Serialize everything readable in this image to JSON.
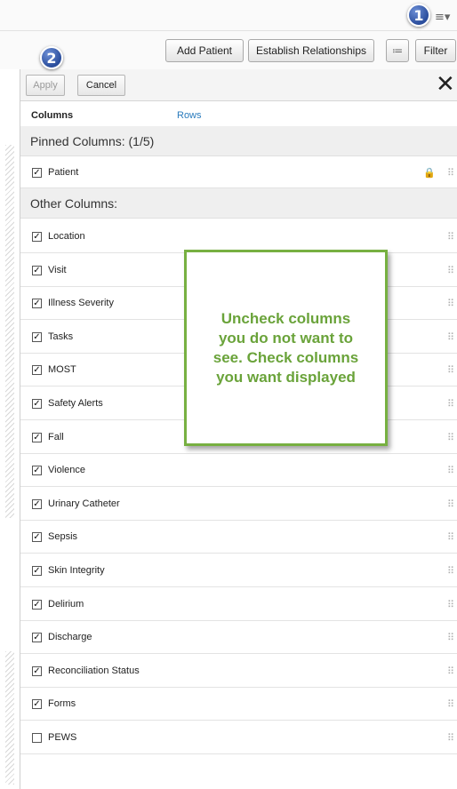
{
  "toolbar": {
    "menu_icon": "≡▾",
    "add_patient_label": "Add Patient",
    "establish_relationships_label": "Establish Relationships",
    "settings_icon": "≔",
    "filter_label": "Filter"
  },
  "badges": {
    "one": "1",
    "two": "2"
  },
  "panel": {
    "apply_label": "Apply",
    "cancel_label": "Cancel",
    "close_icon": "✕",
    "tabs": {
      "columns": "Columns",
      "rows": "Rows"
    },
    "pinned_header": "Pinned Columns: (1/5)",
    "other_header": "Other Columns:",
    "pinned_items": [
      {
        "label": "Patient",
        "checked": true,
        "locked": true
      }
    ],
    "other_items": [
      {
        "label": "Location",
        "checked": true
      },
      {
        "label": "Visit",
        "checked": true
      },
      {
        "label": "Illness Severity",
        "checked": true
      },
      {
        "label": "Tasks",
        "checked": true
      },
      {
        "label": "MOST",
        "checked": true
      },
      {
        "label": "Safety Alerts",
        "checked": true
      },
      {
        "label": "Fall",
        "checked": true
      },
      {
        "label": "Violence",
        "checked": true
      },
      {
        "label": "Urinary Catheter",
        "checked": true
      },
      {
        "label": "Sepsis",
        "checked": true
      },
      {
        "label": "Skin Integrity",
        "checked": true
      },
      {
        "label": "Delirium",
        "checked": true
      },
      {
        "label": "Discharge",
        "checked": true
      },
      {
        "label": "Reconciliation Status",
        "checked": true
      },
      {
        "label": "Forms",
        "checked": true
      },
      {
        "label": "PEWS",
        "checked": false
      }
    ],
    "drag_icon": "⠿",
    "lock_icon": "🔒",
    "check_mark": "✓"
  },
  "callout": {
    "text": "Uncheck columns\nyou do not want to\nsee. Check columns\nyou want displayed"
  },
  "colors": {
    "callout_green": "#6aa33a",
    "link_blue": "#2a7bbd",
    "badge_blue": "#2a4d9c"
  }
}
